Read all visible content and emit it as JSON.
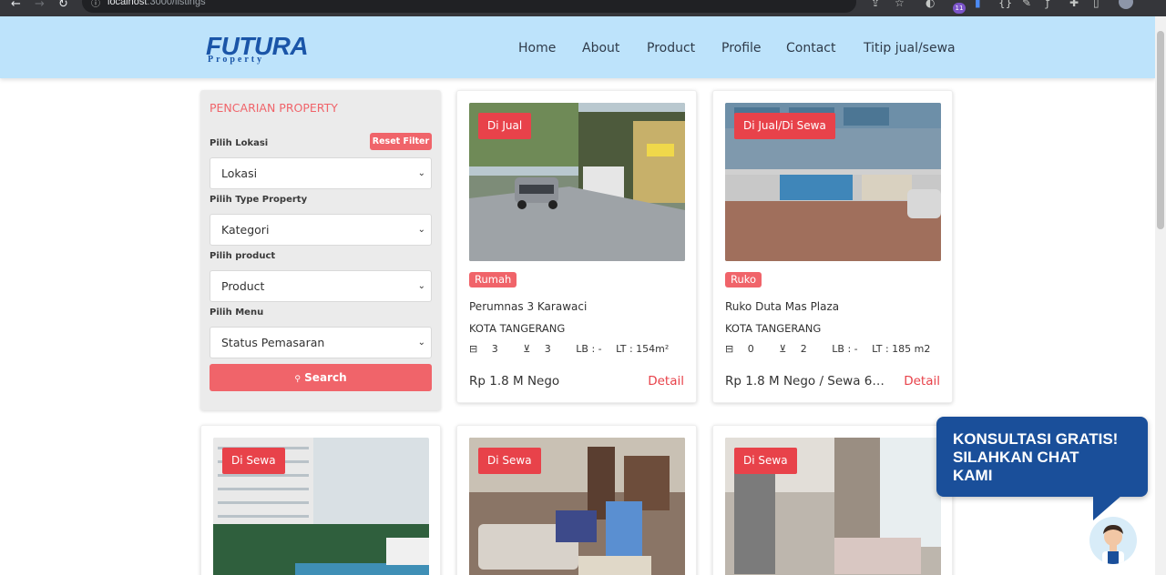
{
  "browser": {
    "url_host": "localhost",
    "url_path": ":3000/listings",
    "extension_badge": "11"
  },
  "header": {
    "logo_main": "FUTURA",
    "logo_sub": "Property",
    "nav": [
      "Home",
      "About",
      "Product",
      "Profile",
      "Contact",
      "Titip jual/sewa"
    ]
  },
  "filter": {
    "title": "PENCARIAN PROPERTY",
    "reset_label": "Reset Filter",
    "fields": [
      {
        "label": "Pilih Lokasi",
        "value": "Lokasi"
      },
      {
        "label": "Pilih Type Property",
        "value": "Kategori"
      },
      {
        "label": "Pilih product",
        "value": "Product"
      },
      {
        "label": "Pilih Menu",
        "value": "Status Pemasaran"
      }
    ],
    "search_label": "Search"
  },
  "listings": [
    {
      "status": "Di Jual",
      "type": "Rumah",
      "name": "Perumnas 3 Karawaci",
      "city": "KOTA TANGERANG",
      "beds": "3",
      "baths": "3",
      "lb": "LB : -",
      "lt": "LT : 154m²",
      "price": "Rp 1.8 M Nego",
      "detail": "Detail"
    },
    {
      "status": "Di Jual/Di Sewa",
      "type": "Ruko",
      "name": "Ruko Duta Mas Plaza",
      "city": "KOTA TANGERANG",
      "beds": "0",
      "baths": "2",
      "lb": "LB : -",
      "lt": "LT : 185 m2",
      "price": "Rp 1.8 M Nego / Sewa 60...",
      "detail": "Detail"
    },
    {
      "status": "Di Sewa"
    },
    {
      "status": "Di Sewa"
    },
    {
      "status": "Di Sewa"
    }
  ],
  "chat": {
    "line1": "KONSULTASI GRATIS!",
    "line2": "SILAHKAN CHAT",
    "line3": "KAMI"
  },
  "colors": {
    "header_bg": "#bde3fb",
    "accent": "#f0646a",
    "badge_red": "#e8424a",
    "brand_blue": "#1a55a8",
    "chat_blue": "#1a4f9a"
  }
}
